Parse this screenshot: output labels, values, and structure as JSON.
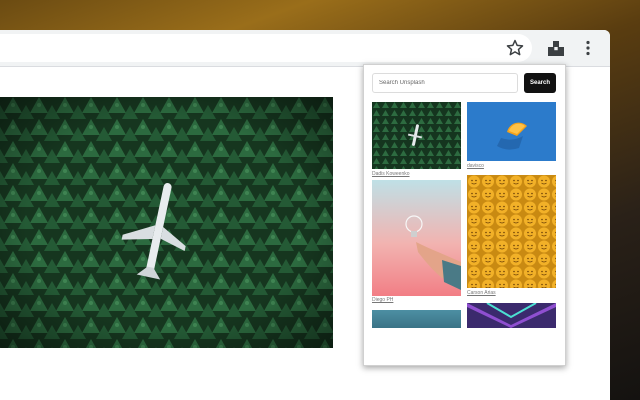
{
  "popup": {
    "search": {
      "placeholder": "Search Unsplash",
      "button_label": "Search"
    },
    "photos": [
      {
        "credit": "Dadis Koweenko",
        "subject": "forest with plane",
        "column": "left"
      },
      {
        "credit": "davisco",
        "subject": "orange slice on blue",
        "column": "right"
      },
      {
        "credit": "Diego PH",
        "subject": "hand holding light bulb",
        "column": "left"
      },
      {
        "credit": "Carson Arias",
        "subject": "yellow smiley balls",
        "column": "right"
      },
      {
        "credit": "",
        "subject": "teal water",
        "column": "left"
      },
      {
        "credit": "",
        "subject": "purple neon",
        "column": "right"
      }
    ]
  },
  "toolbar": {
    "icons": [
      "star-icon",
      "extension-icon",
      "more-vert-icon"
    ]
  },
  "colors": {
    "toolbar_bg": "#f1f3f4",
    "search_button": "#111111",
    "forest": "#1f4a2e"
  }
}
